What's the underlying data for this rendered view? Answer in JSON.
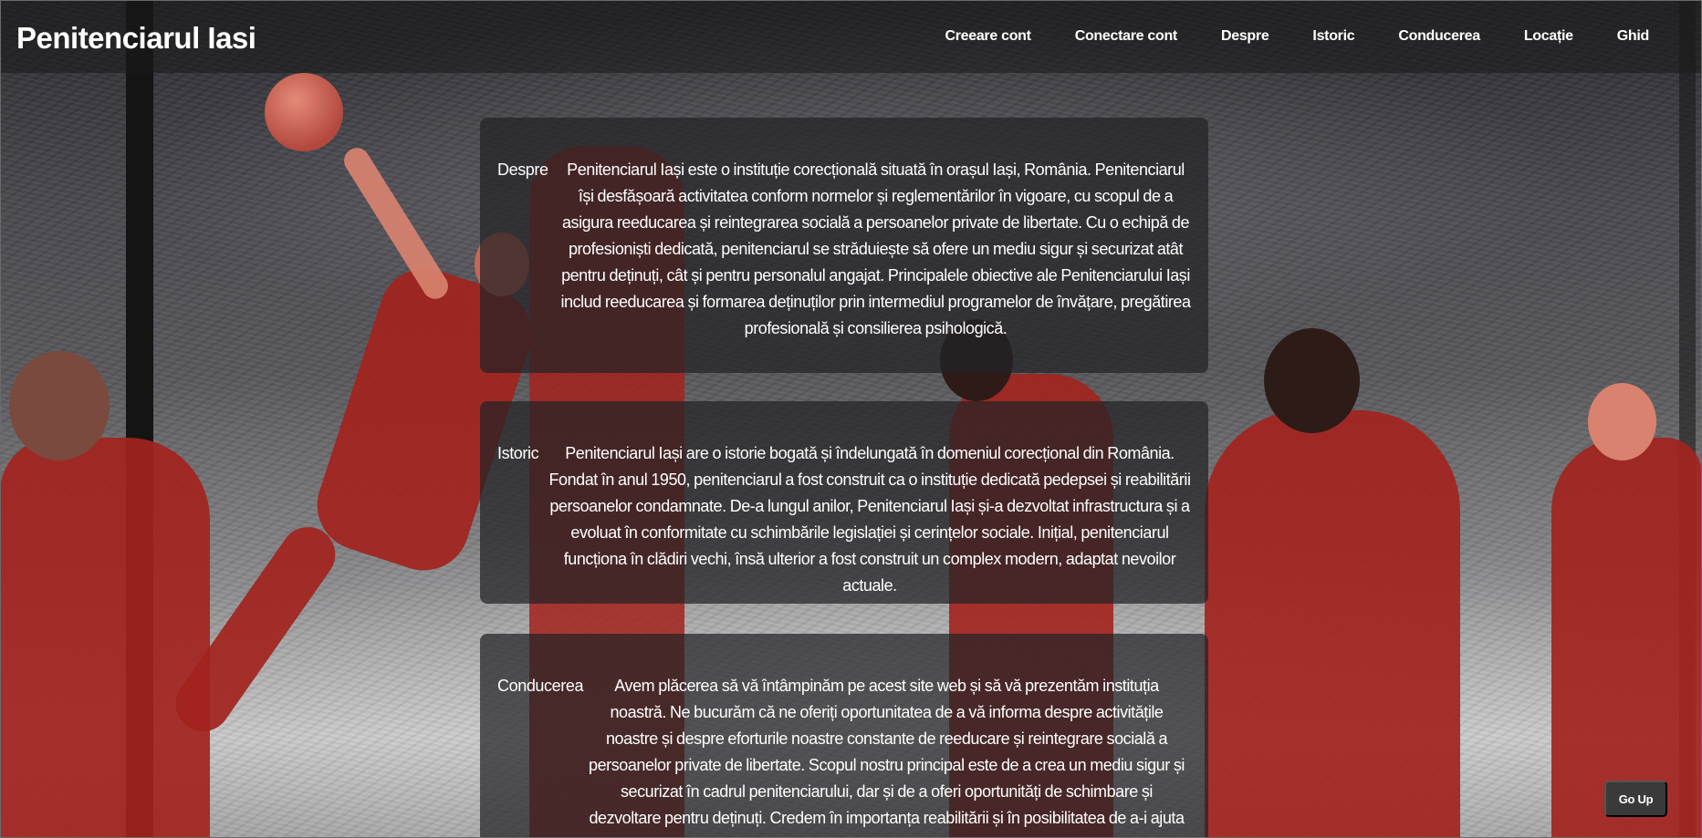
{
  "site": {
    "title": "Penitenciarul Iasi"
  },
  "nav": {
    "items": [
      {
        "key": "creeare-cont",
        "label": "Creeare cont"
      },
      {
        "key": "conectare-cont",
        "label": "Conectare cont"
      },
      {
        "key": "despre",
        "label": "Despre"
      },
      {
        "key": "istoric",
        "label": "Istoric"
      },
      {
        "key": "conducerea",
        "label": "Conducerea"
      },
      {
        "key": "locatie",
        "label": "Locație"
      },
      {
        "key": "ghid",
        "label": "Ghid"
      }
    ]
  },
  "sections": {
    "despre": {
      "label": "Despre",
      "text": "Penitenciarul Iași este o instituție corecțională situată în orașul Iași, România. Penitenciarul își desfășoară activitatea conform normelor și reglementărilor în vigoare, cu scopul de a asigura reeducarea și reintegrarea socială a persoanelor private de libertate. Cu o echipă de profesioniști dedicată, penitenciarul se străduiește să ofere un mediu sigur și securizat atât pentru deținuți, cât și pentru personalul angajat. Principalele obiective ale Penitenciarului Iași includ reeducarea și formarea deținuților prin intermediul programelor de învățare, pregătirea profesională și consilierea psihologică."
    },
    "istoric": {
      "label": "Istoric",
      "text": "Penitenciarul Iași are o istorie bogată și îndelungată în domeniul corecțional din România. Fondat în anul 1950, penitenciarul a fost construit ca o instituție dedicată pedepsei și reabilitării persoanelor condamnate. De-a lungul anilor, Penitenciarul Iași și-a dezvoltat infrastructura și a evoluat în conformitate cu schimbările legislației și cerințelor sociale. Inițial, penitenciarul funcționa în clădiri vechi, însă ulterior a fost construit un complex modern, adaptat nevoilor actuale."
    },
    "conducerea": {
      "label": "Conducerea",
      "text": "Avem plăcerea să vă întâmpinăm pe acest site web și să vă prezentăm instituția noastră. Ne bucurăm că ne oferiți oportunitatea de a vă informa despre activitățile noastre și despre eforturile noastre constante de reeducare și reintegrare socială a persoanelor private de libertate. Scopul nostru principal este de a crea un mediu sigur și securizat în cadrul penitenciarului, dar și de a oferi oportunități de schimbare și dezvoltare pentru deținuți. Credem în importanța reabilitării și în posibilitatea de a-i ajuta pe cei care au greșit să se redreseze și să"
    }
  },
  "go_up": {
    "label": "Go Up"
  }
}
